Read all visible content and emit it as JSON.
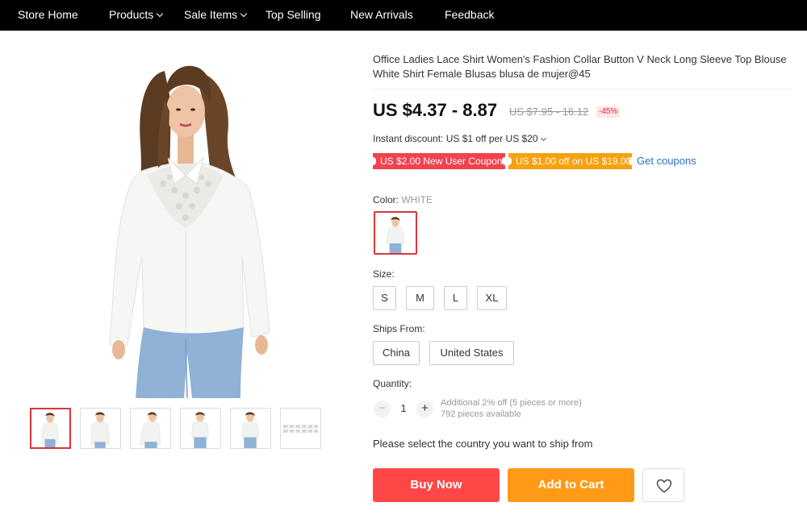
{
  "nav": {
    "store_home": "Store Home",
    "products": "Products",
    "sale_items": "Sale Items",
    "top_selling": "Top Selling",
    "new_arrivals": "New Arrivals",
    "feedback": "Feedback"
  },
  "product": {
    "title": "Office Ladies Lace Shirt Women's Fashion Collar Button V Neck Long Sleeve Top Blouse White Shirt Female Blusas blusa de mujer@45",
    "price": "US $4.37 - 8.87",
    "original_price": "US $7.95 - 16.12",
    "discount": "-45%"
  },
  "promo": {
    "instant_discount": "Instant discount: US $1 off per US $20",
    "coupon_new_user": "US $2.00 New User Coupon",
    "coupon_off": "US $1.00 off on US $19.00",
    "get_coupons": "Get coupons"
  },
  "color": {
    "label": "Color:",
    "selected": "WHITE"
  },
  "size": {
    "label": "Size:",
    "options": [
      "S",
      "M",
      "L",
      "XL"
    ]
  },
  "ships_from": {
    "label": "Ships From:",
    "options": [
      "China",
      "United States"
    ]
  },
  "quantity": {
    "label": "Quantity:",
    "minus": "−",
    "plus": "+",
    "value": "1",
    "note_discount": "Additional 2% off (5 pieces or more)",
    "note_available": "792 pieces available"
  },
  "shipping_message": "Please select the country you want to ship from",
  "actions": {
    "buy_now": "Buy Now",
    "add_to_cart": "Add to Cart"
  },
  "icons": {
    "wishlist": "heart-icon",
    "dropdown": "chevron-down-icon"
  },
  "colors": {
    "accent_red": "#ff4747",
    "accent_orange": "#ff9a16",
    "link_blue": "#2a6fcf",
    "selected_border": "#d9363e"
  }
}
